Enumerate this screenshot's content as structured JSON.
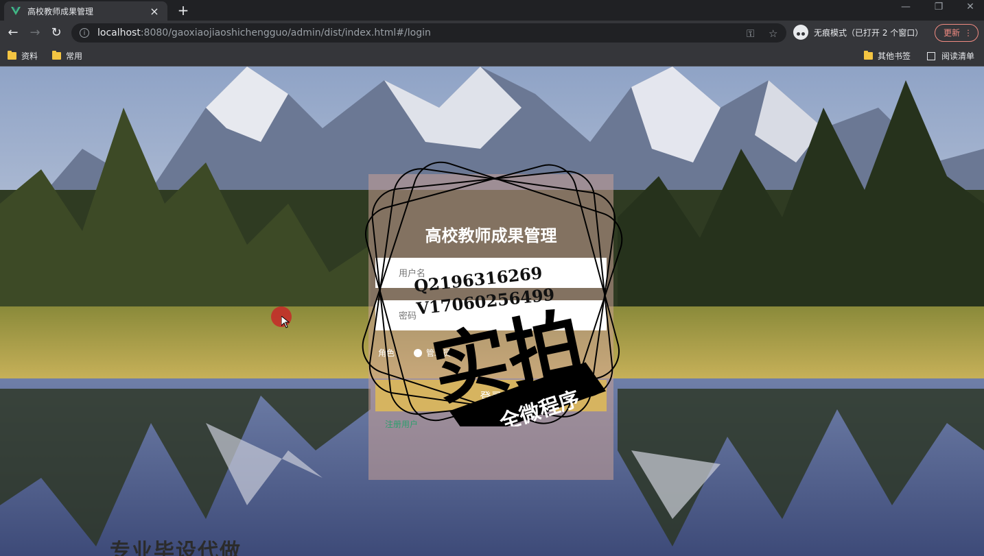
{
  "browser": {
    "tab_title": "高校教师成果管理",
    "new_tab_symbol": "+",
    "url_host": "localhost",
    "url_path": ":8080/gaoxiaojiaoshichengguo/admin/dist/index.html#/login",
    "incognito_text": "无痕模式（已打开 2 个窗口）",
    "update_label": "更新",
    "bookmarks": [
      {
        "label": "资料",
        "icon": "folder-icon"
      },
      {
        "label": "常用",
        "icon": "folder-icon"
      },
      {
        "label": "其他书签",
        "icon": "folder-icon"
      },
      {
        "label": "阅读清单",
        "icon": "reading-list-icon"
      }
    ]
  },
  "login": {
    "title": "高校教师成果管理",
    "username_placeholder": "用户名",
    "password_placeholder": "密码",
    "role_label": "角色",
    "role_option": "管理员",
    "login_button": "登录",
    "register_link": "注册用户"
  },
  "page": {
    "bottom_banner": "专业毕设代做"
  },
  "watermark": {
    "line1": "Q2196316269",
    "line2": "V17060256499",
    "big_text": "实拍",
    "ribbon_text": "全微程序"
  },
  "colors": {
    "chrome_dark": "#202124",
    "chrome_mid": "#35363a",
    "card_bg": "rgba(200,160,150,0.55)",
    "login_button": "#d6b460",
    "register_link": "#2e9e6e"
  }
}
